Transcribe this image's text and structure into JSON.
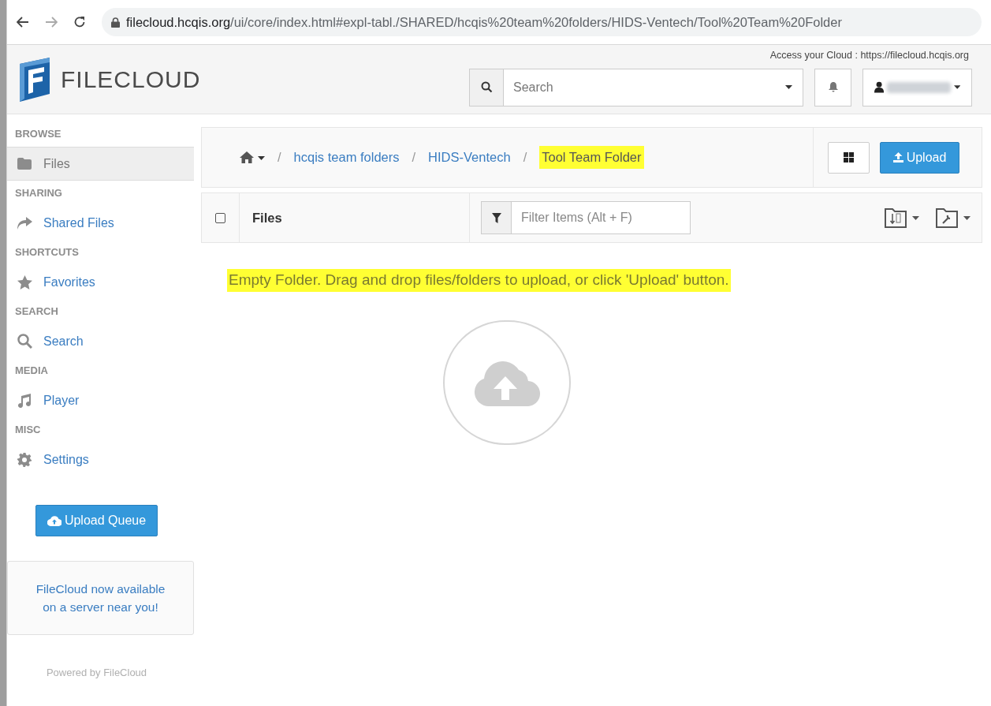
{
  "browser": {
    "url_host": "filecloud.hcqis.org",
    "url_path": "/ui/core/index.html#expl-tabl./SHARED/hcqis%20team%20folders/HIDS-Ventech/Tool%20Team%20Folder"
  },
  "header": {
    "logo": "FILECLOUD",
    "access_label": "Access your Cloud : https://filecloud.hcqis.org",
    "search": {
      "placeholder": "Search"
    }
  },
  "sidebar": {
    "sections": [
      {
        "title": "BROWSE",
        "items": [
          {
            "label": "Files",
            "kind": "folder",
            "selected": true
          }
        ]
      },
      {
        "title": "SHARING",
        "items": [
          {
            "label": "Shared Files",
            "kind": "share",
            "selected": false
          }
        ]
      },
      {
        "title": "SHORTCUTS",
        "items": [
          {
            "label": "Favorites",
            "kind": "star",
            "selected": false
          }
        ]
      },
      {
        "title": "SEARCH",
        "items": [
          {
            "label": "Search",
            "kind": "search",
            "selected": false
          }
        ]
      },
      {
        "title": "MEDIA",
        "items": [
          {
            "label": "Player",
            "kind": "music",
            "selected": false
          }
        ]
      },
      {
        "title": "MISC",
        "items": [
          {
            "label": "Settings",
            "kind": "gear",
            "selected": false
          }
        ]
      }
    ],
    "upload_queue_button": "Upload Queue",
    "promo": "FileCloud now available on a server near you!",
    "footer": "Powered by FileCloud"
  },
  "breadcrumbs": [
    {
      "separator": "/",
      "label": "hcqis team folders",
      "highlighted": false
    },
    {
      "separator": "/",
      "label": "HIDS-Ventech",
      "highlighted": false
    },
    {
      "separator": "/",
      "label": "Tool Team Folder",
      "highlighted": true
    }
  ],
  "upload_button": "Upload",
  "list_header": {
    "title": "Files",
    "checked": false,
    "filter": {
      "placeholder": "Filter Items (Alt + F)"
    }
  },
  "empty_message": {
    "text": "Empty Folder. Drag and drop files/folders to upload, or click 'Upload' button.",
    "highlighted": true
  }
}
